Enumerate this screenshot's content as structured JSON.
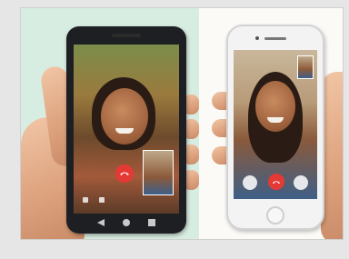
{
  "photo": {
    "subject": "video-call-on-two-phones"
  },
  "colors": {
    "left_background": "#d8ede2",
    "right_background": "#fbfaf7",
    "end_call": "#e53935"
  },
  "icons": {
    "end_call": "phone-hangup-icon",
    "camera_switch": "camera-switch-icon",
    "mic": "microphone-icon",
    "video": "video-icon"
  }
}
